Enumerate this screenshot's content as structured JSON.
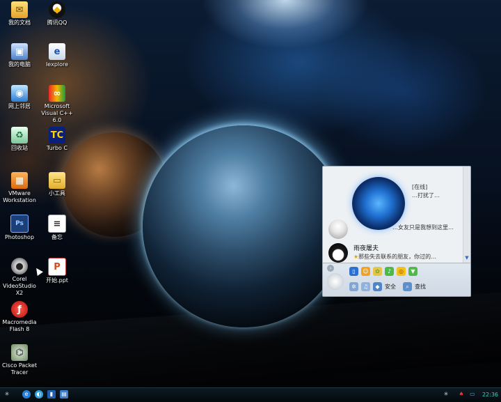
{
  "desktop_icons": [
    {
      "label": "我的文档",
      "icon": "documents-folder-icon"
    },
    {
      "label": "腾讯QQ",
      "icon": "qq-penguin-icon"
    },
    {
      "label": "我的电脑",
      "icon": "computer-icon"
    },
    {
      "label": "Iexplore",
      "icon": "internet-explorer-icon"
    },
    {
      "label": "网上邻居",
      "icon": "network-icon"
    },
    {
      "label": "Microsoft Visual C++ 6.0",
      "icon": "visual-cpp-icon"
    },
    {
      "label": "回收站",
      "icon": "recycle-bin-icon"
    },
    {
      "label": "Turbo C",
      "icon": "turbo-c-icon"
    },
    {
      "label": "VMware Workstation",
      "icon": "vmware-icon"
    },
    {
      "label": "小工具",
      "icon": "folder-icon"
    },
    {
      "label": "Photoshop",
      "icon": "photoshop-icon"
    },
    {
      "label": "备忘",
      "icon": "notepad-icon"
    },
    {
      "label": "Corel VideoStudio X2",
      "icon": "corel-videostudio-icon"
    },
    {
      "label": "开始.ppt",
      "icon": "powerpoint-file-icon"
    },
    {
      "label": "Macromedia Flash 8",
      "icon": "flash-icon"
    },
    {
      "label": "Cisco Packet Tracer",
      "icon": "cisco-packet-tracer-icon"
    }
  ],
  "qq_panel": {
    "contacts": [
      {
        "name": "",
        "status": "[在线]",
        "status2": "…打扰了…"
      },
      {
        "name": "",
        "status": "…女友只是我想到这里…"
      },
      {
        "name": "雨夜屠夫",
        "status": "那些失去联系的朋友，你过的…"
      }
    ],
    "toolbar_top": [
      "phone-icon",
      "people-icon",
      "pet-icon",
      "music-icon",
      "game-icon",
      "shield-icon"
    ],
    "toolbar_bottom": {
      "security_label": "安全",
      "search_label": "查找"
    }
  },
  "taskbar": {
    "clock": "22:36",
    "quick_launch": [
      "start-icon",
      "ie-icon",
      "explorer-icon",
      "media-icon",
      "desktop-icon"
    ],
    "tray": [
      "settings-icon",
      "qq-tray-icon",
      "monitor-icon"
    ]
  },
  "colors": {
    "taskbar_bg": "#07121a",
    "clock": "#39d4c0",
    "panel_bg": "#eef1f4"
  }
}
